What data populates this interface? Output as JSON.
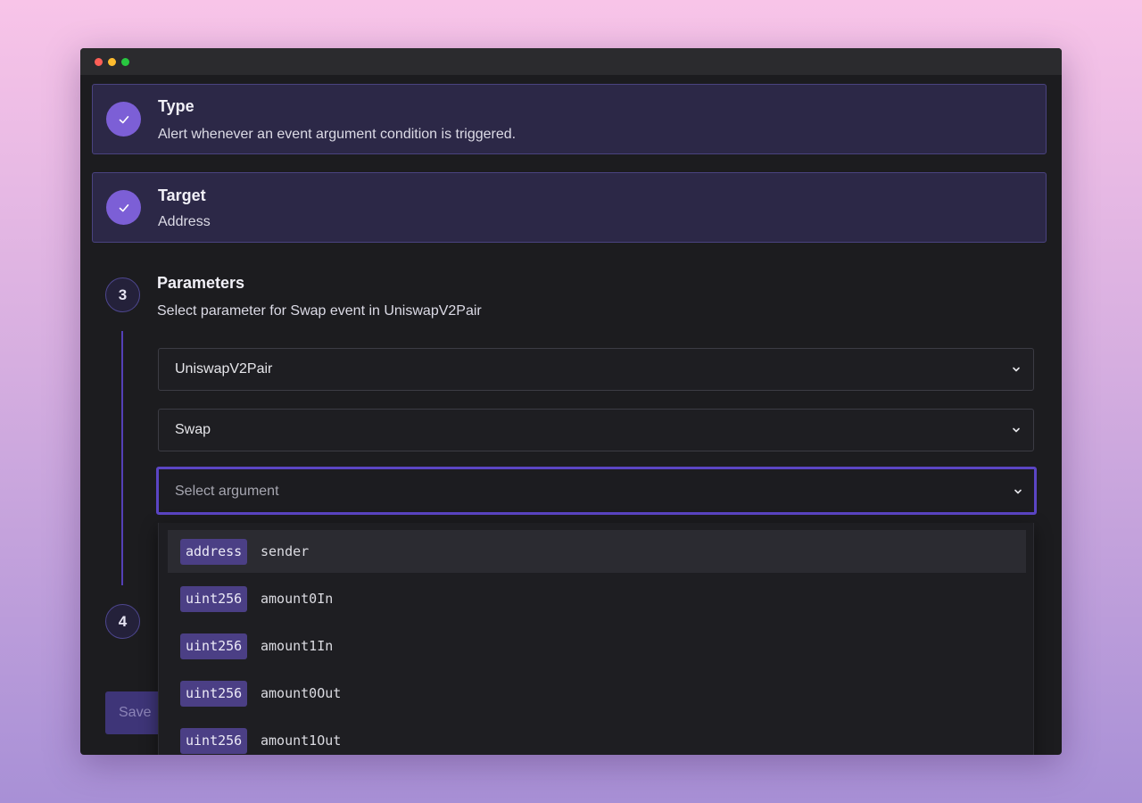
{
  "steps": {
    "type": {
      "title": "Type",
      "subtitle": "Alert whenever an event argument condition is triggered."
    },
    "target": {
      "title": "Target",
      "subtitle": "Address"
    },
    "parameters": {
      "number": "3",
      "title": "Parameters",
      "subtitle": "Select parameter for Swap event in UniswapV2Pair"
    },
    "next": {
      "number": "4"
    }
  },
  "selects": {
    "contract": {
      "value": "UniswapV2Pair"
    },
    "event": {
      "value": "Swap"
    },
    "argument": {
      "placeholder": "Select argument"
    }
  },
  "dropdown": {
    "options": [
      {
        "type": "address",
        "name": "sender",
        "highlighted": true
      },
      {
        "type": "uint256",
        "name": "amount0In"
      },
      {
        "type": "uint256",
        "name": "amount1In"
      },
      {
        "type": "uint256",
        "name": "amount0Out"
      },
      {
        "type": "uint256",
        "name": "amount1Out"
      }
    ]
  },
  "footer": {
    "save_label": "Save"
  },
  "colors": {
    "accent": "#7c5fd6",
    "focus_border": "#5b45c4",
    "tag_bg": "#4b3f85"
  },
  "icons": {
    "check": "check-icon",
    "chevron": "chevron-down-icon"
  }
}
